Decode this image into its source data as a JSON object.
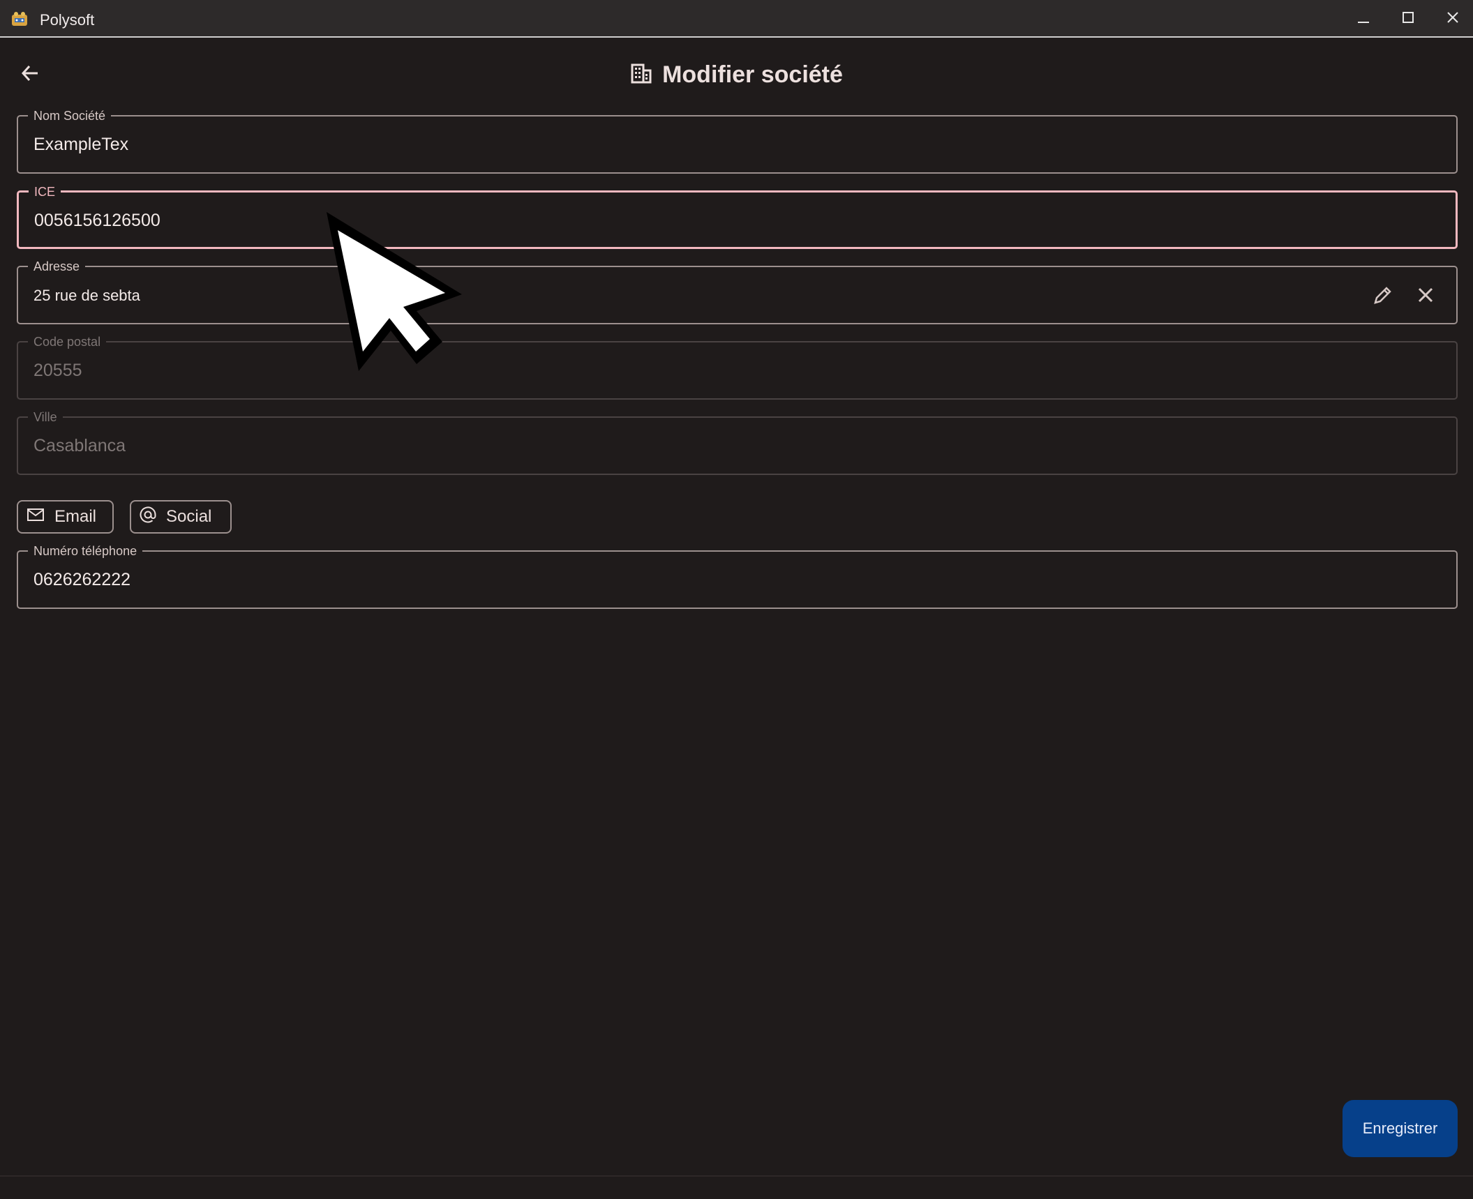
{
  "window": {
    "title": "Polysoft",
    "icons": [
      "app-logo-icon",
      "minimize-icon",
      "maximize-icon",
      "close-icon"
    ]
  },
  "header": {
    "title": "Modifier société",
    "icons": [
      "arrow-left-icon",
      "building-icon"
    ]
  },
  "form": {
    "nom": {
      "label": "Nom Société",
      "value": "ExampleTex"
    },
    "ice": {
      "label": "ICE",
      "value": "0056156126500"
    },
    "adresse": {
      "label": "Adresse",
      "value": "25 rue de sebta"
    },
    "code_postal": {
      "label": "Code postal",
      "value": "20555"
    },
    "ville": {
      "label": "Ville",
      "value": "Casablanca"
    },
    "telephone": {
      "label": "Numéro téléphone",
      "value": "0626262222"
    }
  },
  "chips": {
    "email": "Email",
    "social": "Social"
  },
  "actions": {
    "save": "Enregistrer"
  },
  "colors": {
    "background": "#1f1b1b",
    "focus_outline": "#f2b8bf",
    "primary_button": "#06408a"
  }
}
